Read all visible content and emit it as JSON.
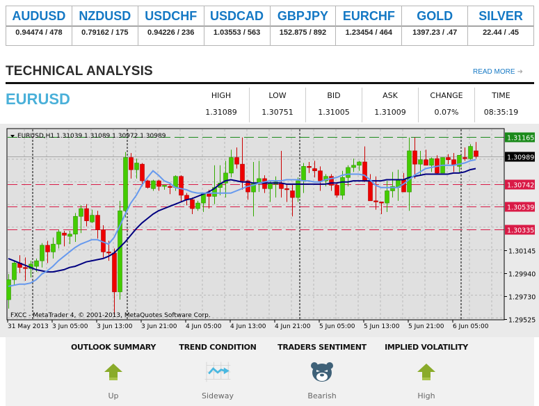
{
  "ticker": [
    {
      "symbol": "AUDUSD",
      "quote": "0.94474 / 478"
    },
    {
      "symbol": "NZDUSD",
      "quote": "0.79162 / 175"
    },
    {
      "symbol": "USDCHF",
      "quote": "0.94226 / 236"
    },
    {
      "symbol": "USDCAD",
      "quote": "1.03553 / 563"
    },
    {
      "symbol": "GBPJPY",
      "quote": "152.875 / 892"
    },
    {
      "symbol": "EURCHF",
      "quote": "1.23454 / 464"
    },
    {
      "symbol": "GOLD",
      "quote": "1397.23 / .47"
    },
    {
      "symbol": "SILVER",
      "quote": "22.44 / .45"
    }
  ],
  "section": {
    "title": "TECHNICAL ANALYSIS",
    "read_more": "READ MORE",
    "read_more_icon": "arrow-right-icon"
  },
  "instrument": {
    "pair": "EURUSD",
    "quotes": [
      {
        "label": "HIGH",
        "value": "1.31089"
      },
      {
        "label": "LOW",
        "value": "1.30751"
      },
      {
        "label": "BID",
        "value": "1.31005"
      },
      {
        "label": "ASK",
        "value": "1.31009"
      },
      {
        "label": "CHANGE",
        "value": "0.07%"
      },
      {
        "label": "TIME",
        "value": "08:35:19"
      }
    ]
  },
  "chart_data": {
    "type": "candlestick",
    "title": "EURUSD,H1  1.31039 1.31089 1.30972 1.30989",
    "symbol": "EURUSD",
    "timeframe": "H1",
    "last_ohlc": [
      1.31039,
      1.31089,
      1.30972,
      1.30989
    ],
    "watermark": "FXCC - MetaTrader 4, © 2001-2013, MetaQuotes Software Corp.",
    "ylim": [
      1.29525,
      1.31165
    ],
    "y_ticks": [
      "1.31165",
      "1.30989",
      "1.30742",
      "1.30539",
      "1.30335",
      "1.30145",
      "1.29940",
      "1.29730",
      "1.29525"
    ],
    "y_tick_values": [
      1.30145,
      1.2994,
      1.2973,
      1.29525
    ],
    "x_ticks": [
      "31 May 2013",
      "3 Jun 05:00",
      "3 Jun 13:00",
      "3 Jun 21:00",
      "4 Jun 05:00",
      "4 Jun 13:00",
      "4 Jun 21:00",
      "5 Jun 05:00",
      "5 Jun 13:00",
      "5 Jun 21:00",
      "6 Jun 05:00"
    ],
    "x_tick_bar_index": [
      0,
      7,
      15,
      23,
      31,
      39,
      47,
      55,
      63,
      71,
      79
    ],
    "day_separators_bar_index": [
      3,
      20,
      51,
      80
    ],
    "grid": true,
    "price_levels": [
      {
        "name": "resistance-high",
        "value": 1.31165,
        "label": "1.31165",
        "color": "#1a8a1a",
        "style": "dashed"
      },
      {
        "name": "current-bid",
        "value": 1.30989,
        "label": "1.30989",
        "color": "#000000",
        "style": "solid"
      },
      {
        "name": "level-1",
        "value": 1.30742,
        "label": "1.30742",
        "color": "#d91a46",
        "style": "dashed"
      },
      {
        "name": "level-2",
        "value": 1.30539,
        "label": "1.30539",
        "color": "#d91a46",
        "style": "dashed"
      },
      {
        "name": "level-3",
        "value": 1.30335,
        "label": "1.30335",
        "color": "#d91a46",
        "style": "dashed"
      }
    ],
    "colors": {
      "up": "#44cc00",
      "down": "#ee0000",
      "ma_fast": "#6699ee",
      "ma_slow": "#000080"
    },
    "candles": [
      [
        1.297,
        1.2993,
        1.2962,
        1.2988
      ],
      [
        1.2988,
        1.3005,
        1.2983,
        1.3003
      ],
      [
        1.3003,
        1.301,
        1.2994,
        1.2999
      ],
      [
        1.2999,
        1.3008,
        1.2987,
        1.2998
      ],
      [
        1.2998,
        1.3005,
        1.299,
        1.3002
      ],
      [
        1.3,
        1.3007,
        1.2995,
        1.3005
      ],
      [
        1.3005,
        1.3021,
        1.2999,
        1.3019
      ],
      [
        1.3019,
        1.3023,
        1.3003,
        1.3013
      ],
      [
        1.3013,
        1.3026,
        1.3007,
        1.302
      ],
      [
        1.302,
        1.3033,
        1.3016,
        1.3031
      ],
      [
        1.303,
        1.3032,
        1.3018,
        1.3028
      ],
      [
        1.3027,
        1.3032,
        1.302,
        1.3029
      ],
      [
        1.3029,
        1.3048,
        1.3022,
        1.3045
      ],
      [
        1.3045,
        1.3055,
        1.303,
        1.3052
      ],
      [
        1.3052,
        1.3056,
        1.3036,
        1.3041
      ],
      [
        1.304,
        1.3051,
        1.3039,
        1.3046
      ],
      [
        1.3046,
        1.305,
        1.3025,
        1.3033
      ],
      [
        1.3033,
        1.3037,
        1.3008,
        1.3013
      ],
      [
        1.3013,
        1.3023,
        1.3005,
        1.3012
      ],
      [
        1.3012,
        1.3016,
        1.2956,
        1.2977
      ],
      [
        1.2977,
        1.3059,
        1.297,
        1.305
      ],
      [
        1.305,
        1.3103,
        1.3044,
        1.3098
      ],
      [
        1.3098,
        1.3102,
        1.3079,
        1.3087
      ],
      [
        1.3087,
        1.3097,
        1.3079,
        1.3093
      ],
      [
        1.3092,
        1.3093,
        1.3072,
        1.3077
      ],
      [
        1.3077,
        1.3078,
        1.307,
        1.3071
      ],
      [
        1.307,
        1.3078,
        1.3068,
        1.3077
      ],
      [
        1.3077,
        1.3078,
        1.3068,
        1.3072
      ],
      [
        1.3072,
        1.3073,
        1.3069,
        1.3073
      ],
      [
        1.3072,
        1.3074,
        1.3065,
        1.3071
      ],
      [
        1.3071,
        1.3082,
        1.3068,
        1.3081
      ],
      [
        1.3081,
        1.3082,
        1.3058,
        1.3064
      ],
      [
        1.3064,
        1.3066,
        1.3055,
        1.306
      ],
      [
        1.306,
        1.3062,
        1.3047,
        1.3052
      ],
      [
        1.3052,
        1.3059,
        1.305,
        1.3057
      ],
      [
        1.3057,
        1.3066,
        1.3049,
        1.3066
      ],
      [
        1.3066,
        1.3069,
        1.3052,
        1.3063
      ],
      [
        1.3063,
        1.3091,
        1.3056,
        1.3071
      ],
      [
        1.3071,
        1.3091,
        1.3064,
        1.3075
      ],
      [
        1.3075,
        1.3095,
        1.3062,
        1.3084
      ],
      [
        1.3084,
        1.3105,
        1.308,
        1.3098
      ],
      [
        1.3098,
        1.3107,
        1.3088,
        1.3092
      ],
      [
        1.3092,
        1.3116,
        1.3069,
        1.3077
      ],
      [
        1.3077,
        1.3078,
        1.306,
        1.3067
      ],
      [
        1.3067,
        1.3094,
        1.3045,
        1.3075
      ],
      [
        1.3075,
        1.3095,
        1.3067,
        1.3079
      ],
      [
        1.3079,
        1.3082,
        1.3066,
        1.307
      ],
      [
        1.307,
        1.3077,
        1.3058,
        1.3075
      ],
      [
        1.3074,
        1.3081,
        1.3062,
        1.3076
      ],
      [
        1.3075,
        1.3104,
        1.3062,
        1.307
      ],
      [
        1.307,
        1.3074,
        1.3058,
        1.3069
      ],
      [
        1.3068,
        1.3074,
        1.3045,
        1.3062
      ],
      [
        1.3062,
        1.308,
        1.3058,
        1.3077
      ],
      [
        1.3077,
        1.3093,
        1.3066,
        1.309
      ],
      [
        1.309,
        1.3094,
        1.3084,
        1.3089
      ],
      [
        1.3088,
        1.3095,
        1.308,
        1.3086
      ],
      [
        1.3086,
        1.309,
        1.3068,
        1.3077
      ],
      [
        1.3077,
        1.3083,
        1.3072,
        1.3081
      ],
      [
        1.3081,
        1.3083,
        1.3068,
        1.3073
      ],
      [
        1.3073,
        1.3076,
        1.3062,
        1.3064
      ],
      [
        1.3064,
        1.3086,
        1.306,
        1.308
      ],
      [
        1.308,
        1.3091,
        1.3072,
        1.3089
      ],
      [
        1.3089,
        1.3097,
        1.3085,
        1.3091
      ],
      [
        1.3091,
        1.3095,
        1.3086,
        1.3094
      ],
      [
        1.3094,
        1.3108,
        1.3076,
        1.3077
      ],
      [
        1.3077,
        1.3083,
        1.306,
        1.3059
      ],
      [
        1.3059,
        1.3081,
        1.3051,
        1.3058
      ],
      [
        1.3058,
        1.3058,
        1.3047,
        1.3057
      ],
      [
        1.3057,
        1.3077,
        1.3049,
        1.3068
      ],
      [
        1.3068,
        1.3085,
        1.3062,
        1.3072
      ],
      [
        1.3071,
        1.3087,
        1.3059,
        1.3078
      ],
      [
        1.3078,
        1.3084,
        1.3073,
        1.3067
      ],
      [
        1.3067,
        1.3116,
        1.305,
        1.3104
      ],
      [
        1.3104,
        1.3116,
        1.3079,
        1.3092
      ],
      [
        1.3092,
        1.3104,
        1.3082,
        1.3096
      ],
      [
        1.3096,
        1.3105,
        1.3093,
        1.3091
      ],
      [
        1.3091,
        1.3098,
        1.3085,
        1.3097
      ],
      [
        1.3097,
        1.31,
        1.3083,
        1.3084
      ],
      [
        1.3084,
        1.3098,
        1.309,
        1.3098
      ],
      [
        1.3098,
        1.3101,
        1.3092,
        1.3096
      ],
      [
        1.3096,
        1.3102,
        1.3085,
        1.3091
      ],
      [
        1.309,
        1.3099,
        1.3084,
        1.31
      ],
      [
        1.3098,
        1.3107,
        1.3095,
        1.3097
      ],
      [
        1.3097,
        1.311,
        1.3096,
        1.3108
      ],
      [
        1.3104,
        1.3112,
        1.3097,
        1.3099
      ]
    ],
    "ma_fast": [
      1.2982,
      1.2983,
      1.2984,
      1.2984,
      1.2985,
      1.2988,
      1.2993,
      1.2996,
      1.3,
      1.3005,
      1.3009,
      1.3013,
      1.3017,
      1.302,
      1.3022,
      1.3024,
      1.3024,
      1.3022,
      1.302,
      1.3026,
      1.3036,
      1.3047,
      1.3057,
      1.3064,
      1.3073,
      1.308,
      1.3086,
      1.3082,
      1.3077,
      1.3075,
      1.3071,
      1.307,
      1.3069,
      1.3067,
      1.3066,
      1.3066,
      1.3066,
      1.3066,
      1.3066,
      1.3066,
      1.3066,
      1.3068,
      1.307,
      1.3072,
      1.3073,
      1.3075,
      1.3076,
      1.3077,
      1.3077,
      1.3077,
      1.3078,
      1.3078,
      1.3078,
      1.3077,
      1.3077,
      1.3076,
      1.3076,
      1.3078,
      1.3079,
      1.308,
      1.3082,
      1.3083,
      1.3083,
      1.3083,
      1.3082,
      1.3078,
      1.3073,
      1.3071,
      1.3071,
      1.3071,
      1.3071,
      1.3074,
      1.3078,
      1.3082,
      1.3085,
      1.3088,
      1.3089,
      1.309,
      1.3091,
      1.3091,
      1.3091,
      1.3092,
      1.3093,
      1.3095,
      1.3096
    ],
    "ma_slow": [
      1.3007,
      1.3005,
      1.3003,
      1.3001,
      1.2999,
      1.2997,
      1.2996,
      1.2995,
      1.2995,
      1.2996,
      1.2997,
      1.2999,
      1.3,
      1.3002,
      1.3004,
      1.3005,
      1.3006,
      1.3007,
      1.3009,
      1.3012,
      1.3017,
      1.3022,
      1.3028,
      1.3034,
      1.3039,
      1.3043,
      1.3047,
      1.305,
      1.3052,
      1.3054,
      1.3056,
      1.3058,
      1.306,
      1.3061,
      1.3063,
      1.3065,
      1.3067,
      1.307,
      1.3074,
      1.3077,
      1.3078,
      1.3077,
      1.3076,
      1.3076,
      1.3075,
      1.3075,
      1.3075,
      1.3075,
      1.3075,
      1.3075,
      1.3074,
      1.3074,
      1.3074,
      1.3074,
      1.3074,
      1.3074,
      1.3074,
      1.3074,
      1.3075,
      1.3075,
      1.3076,
      1.3076,
      1.3077,
      1.3077,
      1.3077,
      1.3077,
      1.3077,
      1.3077,
      1.3078,
      1.3078,
      1.3078,
      1.3078,
      1.308,
      1.3081,
      1.3082,
      1.3083,
      1.3083,
      1.3083,
      1.3083,
      1.3083,
      1.3084,
      1.3084,
      1.3085,
      1.3087,
      1.3088
    ]
  },
  "summary": [
    {
      "heading": "OUTLOOK SUMMARY",
      "icon": "arrow-up-icon",
      "value": "Up"
    },
    {
      "heading": "TREND CONDITION",
      "icon": "sideways-trend-icon",
      "value": "Sideway"
    },
    {
      "heading": "TRADERS SENTIMENT",
      "icon": "bear-icon",
      "value": "Bearish"
    },
    {
      "heading": "IMPLIED VOLATILITY",
      "icon": "arrow-up-icon",
      "value": "High"
    }
  ]
}
